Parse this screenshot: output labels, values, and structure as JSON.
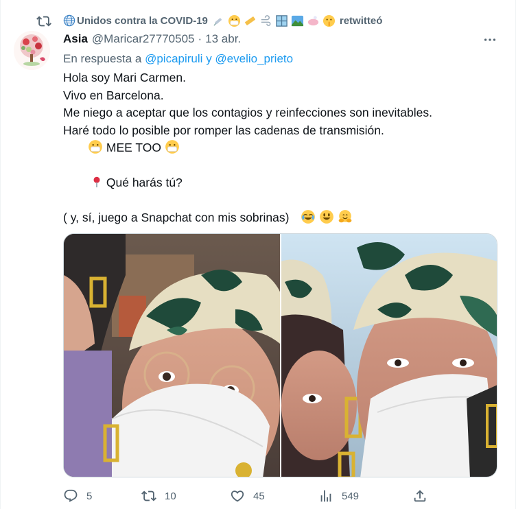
{
  "social_context": {
    "community_name": "Unidos contra la COVID-19",
    "retweeted_label": "retwitteó"
  },
  "tweet": {
    "display_name": "Asia",
    "handle": "@Maricar27770505",
    "separator": "·",
    "date": "13 abr.",
    "reply_prefix": "En respuesta a",
    "mention_1": "@picapiruli",
    "reply_join": "y",
    "mention_2": "@evelio_prieto",
    "lines": {
      "l1": "Hola soy Mari Carmen.",
      "l2": "Vivo en Barcelona.",
      "l3": "Me niego a aceptar que los contagios y reinfecciones son inevitables.",
      "l4": "Haré todo lo posible por romper las cadenas de transmisión.",
      "l5": "MEE TOO",
      "l6": "Qué harás tú?",
      "l7": "( y, sí,  juego a Snapchat con mis sobrinas)"
    }
  },
  "actions": {
    "replies": "5",
    "retweets": "10",
    "likes": "45",
    "views": "549"
  },
  "colors": {
    "text_primary": "#0f1419",
    "text_secondary": "#536471",
    "link": "#1d9bf0"
  },
  "icons": [
    "retweet-icon",
    "globe-icon",
    "more-icon",
    "reply-icon",
    "like-icon",
    "views-icon",
    "share-icon"
  ]
}
